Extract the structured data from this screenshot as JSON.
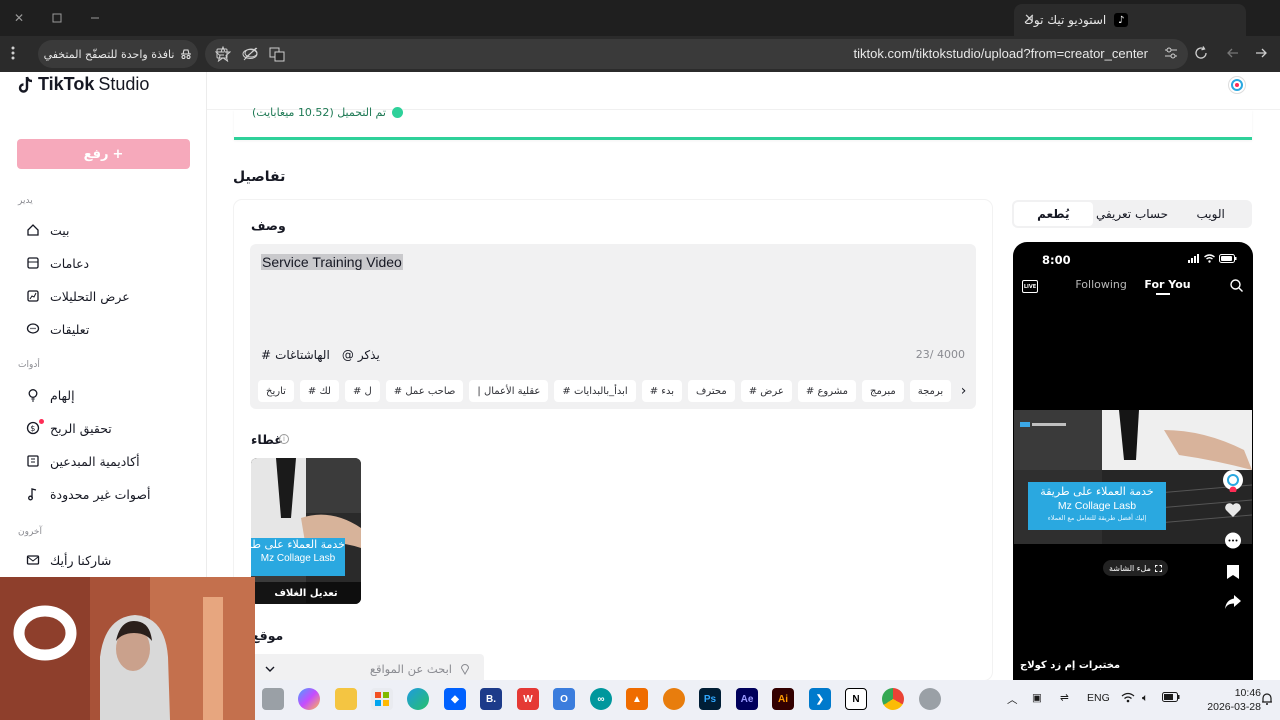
{
  "browser": {
    "tab_title": "استوديو تيك توك",
    "url": "tiktok.com/tiktokstudio/upload?from=creator_center",
    "incognito_label": "نافذة واحدة للتصفّح المتخفي"
  },
  "sidebar": {
    "logo_text": "TikTok",
    "logo_suffix": "Studio",
    "upload_label": "رفع",
    "section_manage": "يدير",
    "manage_items": [
      {
        "label": "بيت",
        "icon": "home-icon"
      },
      {
        "label": "دعامات",
        "icon": "posts-icon"
      },
      {
        "label": "عرض التحليلات",
        "icon": "analytics-icon"
      },
      {
        "label": "تعليقات",
        "icon": "comments-icon"
      }
    ],
    "section_tools": "أدوات",
    "tool_items": [
      {
        "label": "إلهام",
        "icon": "lightbulb-icon"
      },
      {
        "label": "تحقيق الربح",
        "icon": "dollar-icon"
      },
      {
        "label": "أكاديمية المبدعين",
        "icon": "book-icon"
      },
      {
        "label": "أصوات غير محدودة",
        "icon": "music-icon"
      }
    ],
    "section_other": "آخرون",
    "other_items": [
      {
        "label": "شاركنا رأيك",
        "icon": "mail-icon"
      }
    ]
  },
  "upload": {
    "status_text": "تم التحميل (10.52 ميغابايت)"
  },
  "details": {
    "title": "تفاصيل",
    "description_label": "وصف",
    "description_value": "Service Training Video",
    "mention_label": "يذكر",
    "hashtags_label": "الهاشتاغات",
    "char_count": "23/ 4000",
    "hashtag_chips": [
      "تاريخ",
      "# لك",
      "# ل",
      "# صاحب عمل",
      "| عقلية الأعمال",
      "# ابدأ_بالبدايات",
      "# بدء",
      "محترف",
      "# عرض",
      "# مشروع",
      "مبرمج",
      "برمجة"
    ],
    "cover_label": "غطاء",
    "cover_edit_label": "تعديل الغلاف",
    "location_label": "موقع",
    "location_placeholder": "ابحث عن المواقع"
  },
  "preview": {
    "tabs": [
      "يُطعم",
      "حساب تعريفي",
      "الويب"
    ],
    "active_tab": "يُطعم",
    "phone_time": "8:00",
    "nav_following": "Following",
    "nav_for_you": "For You",
    "live_label": "LIVE",
    "fullscreen_label": "ملء الشاشة",
    "username": "مختبرات إم زد كولاج",
    "video_banner_line1": "خدمة العملاء على طريقة",
    "video_banner_line2": "Mz Collage Lasb",
    "video_banner_line3": "إليك أفضل طريقة للتعامل مع العملاء"
  },
  "taskbar": {
    "language": "ENG",
    "time": "10:46",
    "date": "2026-03-28"
  },
  "colors": {
    "accent_pink": "#fe2c55",
    "upload_disabled": "#f6a9bb",
    "success_green": "#2ed19a"
  }
}
